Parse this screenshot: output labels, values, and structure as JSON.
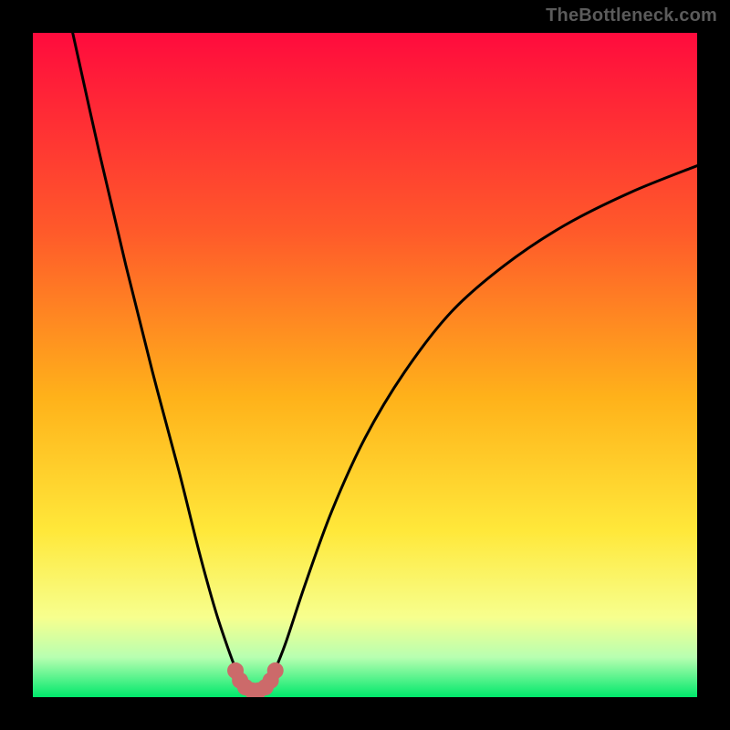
{
  "watermark": "TheBottleneck.com",
  "chart_data": {
    "type": "line",
    "title": "",
    "xlabel": "",
    "ylabel": "",
    "xlim": [
      0,
      100
    ],
    "ylim": [
      0,
      100
    ],
    "grid": false,
    "legend": false,
    "background_gradient_stops": [
      {
        "offset": 0.0,
        "color": "#ff0b3d"
      },
      {
        "offset": 0.3,
        "color": "#ff5a2a"
      },
      {
        "offset": 0.55,
        "color": "#ffb21a"
      },
      {
        "offset": 0.75,
        "color": "#ffe83a"
      },
      {
        "offset": 0.88,
        "color": "#f7ff8e"
      },
      {
        "offset": 0.94,
        "color": "#b8ffb1"
      },
      {
        "offset": 1.0,
        "color": "#00e86b"
      }
    ],
    "series": [
      {
        "name": "left-branch",
        "stroke": "#000000",
        "points": [
          {
            "x": 6.0,
            "y": 100.0
          },
          {
            "x": 10.0,
            "y": 82.0
          },
          {
            "x": 14.0,
            "y": 65.0
          },
          {
            "x": 18.0,
            "y": 49.0
          },
          {
            "x": 22.0,
            "y": 34.0
          },
          {
            "x": 25.0,
            "y": 22.0
          },
          {
            "x": 27.5,
            "y": 13.0
          },
          {
            "x": 29.5,
            "y": 7.0
          },
          {
            "x": 31.0,
            "y": 3.0
          }
        ]
      },
      {
        "name": "right-branch",
        "stroke": "#000000",
        "points": [
          {
            "x": 36.0,
            "y": 3.0
          },
          {
            "x": 38.0,
            "y": 8.0
          },
          {
            "x": 41.0,
            "y": 17.0
          },
          {
            "x": 45.0,
            "y": 28.0
          },
          {
            "x": 50.0,
            "y": 39.0
          },
          {
            "x": 56.0,
            "y": 49.0
          },
          {
            "x": 63.0,
            "y": 58.0
          },
          {
            "x": 71.0,
            "y": 65.0
          },
          {
            "x": 80.0,
            "y": 71.0
          },
          {
            "x": 90.0,
            "y": 76.0
          },
          {
            "x": 100.0,
            "y": 80.0
          }
        ]
      },
      {
        "name": "valley-dots",
        "stroke": "#cc6a6a",
        "dotted": true,
        "points": [
          {
            "x": 30.5,
            "y": 4.0
          },
          {
            "x": 31.2,
            "y": 2.5
          },
          {
            "x": 32.0,
            "y": 1.5
          },
          {
            "x": 33.0,
            "y": 1.0
          },
          {
            "x": 34.0,
            "y": 1.0
          },
          {
            "x": 35.0,
            "y": 1.5
          },
          {
            "x": 35.8,
            "y": 2.5
          },
          {
            "x": 36.5,
            "y": 4.0
          }
        ]
      }
    ]
  }
}
